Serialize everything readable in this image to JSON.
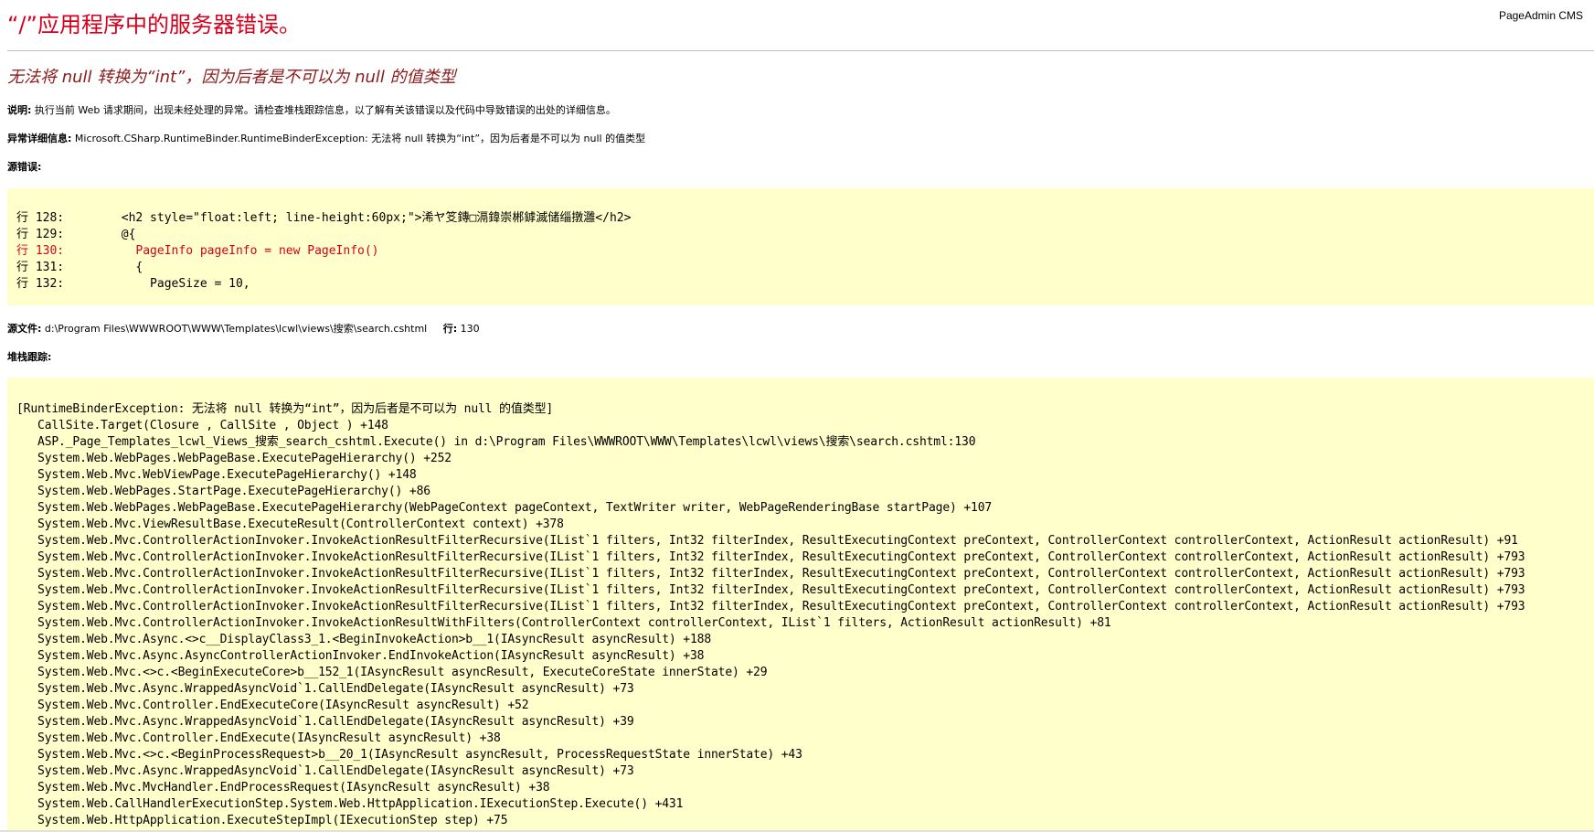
{
  "brand": "PageAdmin CMS",
  "title": "“/”应用程序中的服务器错误。",
  "subtitle": "无法将 null 转换为“int”，因为后者是不可以为 null 的值类型",
  "description": {
    "label": "说明:",
    "text": "执行当前 Web 请求期间，出现未经处理的异常。请检查堆栈跟踪信息，以了解有关该错误以及代码中导致错误的出处的详细信息。"
  },
  "exception": {
    "label": "异常详细信息:",
    "text": "Microsoft.CSharp.RuntimeBinder.RuntimeBinderException: 无法将 null 转换为“int”，因为后者是不可以为 null 的值类型"
  },
  "source_error_label": "源错误:",
  "source_lines": [
    {
      "prefix": "行 128:",
      "code": "        <h2 style=\"float:left; line-height:60px;\">浠ヤ笅鏄□滆鍏崇郴鎼滅储缁撴灉</h2>",
      "highlight": false
    },
    {
      "prefix": "行 129:",
      "code": "        @{",
      "highlight": false
    },
    {
      "prefix": "行 130:",
      "code": "          PageInfo pageInfo = new PageInfo()",
      "highlight": true
    },
    {
      "prefix": "行 131:",
      "code": "          {",
      "highlight": false
    },
    {
      "prefix": "行 132:",
      "code": "            PageSize = 10,",
      "highlight": false
    }
  ],
  "source_file": {
    "label": "源文件:",
    "path": "d:\\Program Files\\WWWROOT\\WWW\\Templates\\lcwl\\views\\搜索\\search.cshtml",
    "line_label": "行:",
    "line": "130"
  },
  "stack_trace_label": "堆栈跟踪:",
  "stack_trace": [
    "[RuntimeBinderException: 无法将 null 转换为“int”，因为后者是不可以为 null 的值类型]",
    "   CallSite.Target(Closure , CallSite , Object ) +148",
    "   ASP._Page_Templates_lcwl_Views_搜索_search_cshtml.Execute() in d:\\Program Files\\WWWROOT\\WWW\\Templates\\lcwl\\views\\搜索\\search.cshtml:130",
    "   System.Web.WebPages.WebPageBase.ExecutePageHierarchy() +252",
    "   System.Web.Mvc.WebViewPage.ExecutePageHierarchy() +148",
    "   System.Web.WebPages.StartPage.ExecutePageHierarchy() +86",
    "   System.Web.WebPages.WebPageBase.ExecutePageHierarchy(WebPageContext pageContext, TextWriter writer, WebPageRenderingBase startPage) +107",
    "   System.Web.Mvc.ViewResultBase.ExecuteResult(ControllerContext context) +378",
    "   System.Web.Mvc.ControllerActionInvoker.InvokeActionResultFilterRecursive(IList`1 filters, Int32 filterIndex, ResultExecutingContext preContext, ControllerContext controllerContext, ActionResult actionResult) +91",
    "   System.Web.Mvc.ControllerActionInvoker.InvokeActionResultFilterRecursive(IList`1 filters, Int32 filterIndex, ResultExecutingContext preContext, ControllerContext controllerContext, ActionResult actionResult) +793",
    "   System.Web.Mvc.ControllerActionInvoker.InvokeActionResultFilterRecursive(IList`1 filters, Int32 filterIndex, ResultExecutingContext preContext, ControllerContext controllerContext, ActionResult actionResult) +793",
    "   System.Web.Mvc.ControllerActionInvoker.InvokeActionResultFilterRecursive(IList`1 filters, Int32 filterIndex, ResultExecutingContext preContext, ControllerContext controllerContext, ActionResult actionResult) +793",
    "   System.Web.Mvc.ControllerActionInvoker.InvokeActionResultFilterRecursive(IList`1 filters, Int32 filterIndex, ResultExecutingContext preContext, ControllerContext controllerContext, ActionResult actionResult) +793",
    "   System.Web.Mvc.ControllerActionInvoker.InvokeActionResultWithFilters(ControllerContext controllerContext, IList`1 filters, ActionResult actionResult) +81",
    "   System.Web.Mvc.Async.<>c__DisplayClass3_1.<BeginInvokeAction>b__1(IAsyncResult asyncResult) +188",
    "   System.Web.Mvc.Async.AsyncControllerActionInvoker.EndInvokeAction(IAsyncResult asyncResult) +38",
    "   System.Web.Mvc.<>c.<BeginExecuteCore>b__152_1(IAsyncResult asyncResult, ExecuteCoreState innerState) +29",
    "   System.Web.Mvc.Async.WrappedAsyncVoid`1.CallEndDelegate(IAsyncResult asyncResult) +73",
    "   System.Web.Mvc.Controller.EndExecuteCore(IAsyncResult asyncResult) +52",
    "   System.Web.Mvc.Async.WrappedAsyncVoid`1.CallEndDelegate(IAsyncResult asyncResult) +39",
    "   System.Web.Mvc.Controller.EndExecute(IAsyncResult asyncResult) +38",
    "   System.Web.Mvc.<>c.<BeginProcessRequest>b__20_1(IAsyncResult asyncResult, ProcessRequestState innerState) +43",
    "   System.Web.Mvc.Async.WrappedAsyncVoid`1.CallEndDelegate(IAsyncResult asyncResult) +73",
    "   System.Web.Mvc.MvcHandler.EndProcessRequest(IAsyncResult asyncResult) +38",
    "   System.Web.CallHandlerExecutionStep.System.Web.HttpApplication.IExecutionStep.Execute() +431",
    "   System.Web.HttpApplication.ExecuteStepImpl(IExecutionStep step) +75"
  ],
  "colors": {
    "title": "#d6001c",
    "subtitle": "#8a1b1b",
    "code_background": "#ffffcc",
    "highlight_line": "#d6001c"
  }
}
